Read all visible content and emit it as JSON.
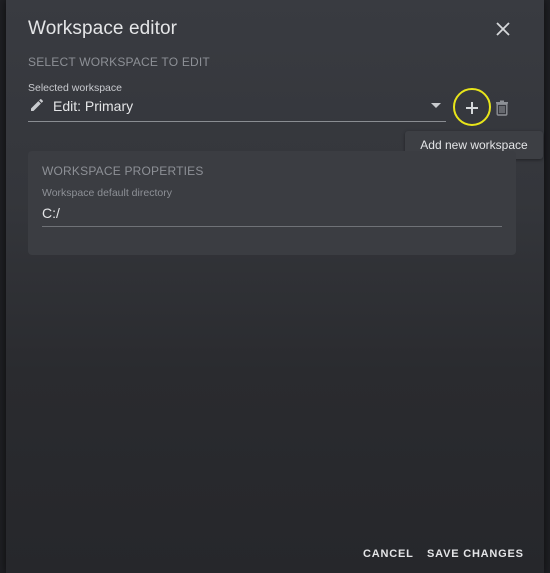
{
  "dialog": {
    "title": "Workspace editor",
    "close_icon": "close-icon"
  },
  "workspace_select": {
    "section_label": "SELECT WORKSPACE TO EDIT",
    "field_label": "Selected workspace",
    "value": "Edit: Primary",
    "leading_icon": "pencil-icon",
    "trailing_icon": "caret-down-icon"
  },
  "actions": {
    "add_icon": "plus-icon",
    "delete_icon": "trash-icon",
    "add_tooltip": "Add new workspace"
  },
  "properties": {
    "section_title": "WORKSPACE PROPERTIES",
    "directory_label": "Workspace default directory",
    "directory_value": "C:/"
  },
  "footer": {
    "cancel_label": "CANCEL",
    "save_label": "SAVE CHANGES"
  },
  "colors": {
    "highlight_ring": "#e8e51a",
    "dialog_bg": "#393b41",
    "panel_bg": "#3b3d42"
  }
}
